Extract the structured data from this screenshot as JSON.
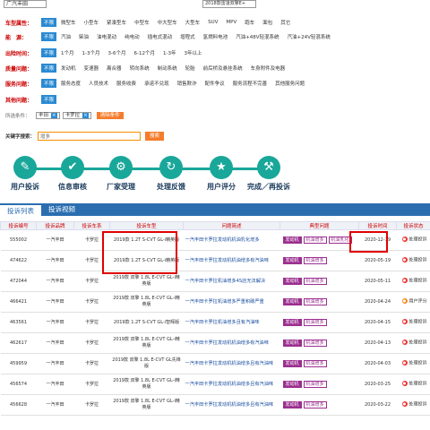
{
  "top": {
    "select1": "广汽丰田",
    "select2": "2018款雷凌双擎E+"
  },
  "filters": [
    {
      "label": "车型属性：",
      "btn": "不限",
      "options": [
        "微型车",
        "小型车",
        "紧凑型车",
        "中型车",
        "中大型车",
        "大型车",
        "SUV",
        "MPV",
        "跑车",
        "面包",
        "其它"
      ]
    },
    {
      "label": "能　源：",
      "btn": "不限",
      "options": [
        "汽油",
        "柴油",
        "油电混动",
        "纯电动",
        "插电式混动",
        "增程式",
        "氢燃料电池",
        "汽油+48V轻混系统",
        "汽油+24V轻混系统"
      ]
    },
    {
      "label": "出险时间：",
      "btn": "不限",
      "options": [
        "1个月",
        "1-3个月",
        "3-6个月",
        "6-12个月",
        "1-3年",
        "3年以上"
      ]
    },
    {
      "label": "质量问题：",
      "btn": "不限",
      "options": [
        "发动机",
        "变速器",
        "离合器",
        "转向系统",
        "制动系统",
        "轮胎",
        "前后桥及悬挂系统",
        "车身附件及电器"
      ]
    },
    {
      "label": "服务问题：",
      "btn": "不限",
      "options": [
        "服务态度",
        "人员技术",
        "服务收费",
        "承诺不兑现",
        "销售欺诈",
        "配件争议",
        "服务流程不完善",
        "其他服务问题"
      ]
    },
    {
      "label": "其他问题：",
      "btn": "不限",
      "options": []
    }
  ],
  "selected": {
    "label": "所选条件：",
    "chips": [
      "丰田",
      "卡罗拉"
    ],
    "clear": "清除条件"
  },
  "keyword": {
    "label": "关键字搜索：",
    "value": "增多",
    "button": "搜索"
  },
  "flow": [
    "用户投诉",
    "信息审核",
    "厂家受理",
    "处理反馈",
    "用户评分",
    "完成／再投诉"
  ],
  "tabs": [
    "投诉列表",
    "投诉视频"
  ],
  "table": {
    "headers": [
      "投诉编号",
      "投诉品牌",
      "投诉车系",
      "投诉车型",
      "问题简述",
      "典型问题",
      "投诉时间",
      "投诉状态"
    ],
    "rows": [
      {
        "id": "555002",
        "brand": "一汽丰田",
        "series": "卡罗拉",
        "model": "2019款 1.2T S-CVT GL-i精英版",
        "brief": "一汽丰田卡罗拉发动机机油乳化增多",
        "tags": [
          "发动机",
          "机油增多",
          "机油乳化"
        ],
        "date": "2020-12-19",
        "status": "处理投诉"
      },
      {
        "id": "474622",
        "brand": "一汽丰田",
        "series": "卡罗拉",
        "model": "2019款 1.2T S-CVT GL-i精英版",
        "brief": "一汽丰田卡罗拉发动机机油增多有汽油味",
        "tags": [
          "发动机",
          "机油增多"
        ],
        "date": "2020-05-19",
        "status": "处理投诉"
      },
      {
        "id": "472044",
        "brand": "一汽丰田",
        "series": "卡罗拉",
        "model": "2019款 双擎 1.8L E-CVT GL-i精英版",
        "brief": "一汽丰田卡罗拉机油增多4S店无法解决",
        "tags": [
          "发动机",
          "机油增多"
        ],
        "date": "2020-05-11",
        "status": "处理投诉"
      },
      {
        "id": "466421",
        "brand": "一汽丰田",
        "series": "卡罗拉",
        "model": "2019款 双擎 1.8L E-CVT GL-i精英版",
        "brief": "一汽丰田卡罗拉机油增多严重积碳严重",
        "tags": [
          "发动机",
          "机油增多"
        ],
        "date": "2020-04-24",
        "status": "用户评分"
      },
      {
        "id": "463561",
        "brand": "一汽丰田",
        "series": "卡罗拉",
        "model": "2019款 1.2T S-CVT GL-i智辉版",
        "brief": "一汽丰田卡罗拉机油增多且有汽油味",
        "tags": [
          "发动机",
          "机油增多"
        ],
        "date": "2020-04-15",
        "status": "处理投诉"
      },
      {
        "id": "462617",
        "brand": "一汽丰田",
        "series": "卡罗拉",
        "model": "2019款 双擎 1.8L E-CVT GL-i精英版",
        "brief": "一汽丰田卡罗拉发动机机油增多有汽油味",
        "tags": [
          "发动机",
          "机油增多"
        ],
        "date": "2020-04-13",
        "status": "处理投诉"
      },
      {
        "id": "459959",
        "brand": "一汽丰田",
        "series": "卡罗拉",
        "model": "2019款 双擎 1.8L E-CVT GL先锋版",
        "brief": "一汽丰田卡罗拉发动机机油增多且有汽油味",
        "tags": [
          "发动机",
          "机油增多"
        ],
        "date": "2020-04-03",
        "status": "处理投诉"
      },
      {
        "id": "456574",
        "brand": "一汽丰田",
        "series": "卡罗拉",
        "model": "2019款 双擎 1.8L E-CVT GL-i精英版",
        "brief": "一汽丰田卡罗拉发动机机油增多且有汽油味",
        "tags": [
          "发动机",
          "机油增多"
        ],
        "date": "2020-03-25",
        "status": "处理投诉"
      },
      {
        "id": "456628",
        "brand": "一汽丰田",
        "series": "卡罗拉",
        "model": "2019款 双擎 1.8L E-CVT GL-i精英版",
        "brief": "一汽丰田卡罗拉发动机机油增多且有汽油味",
        "tags": [
          "发动机",
          "机油增多"
        ],
        "date": "2020-03-22",
        "status": "处理投诉"
      }
    ]
  }
}
